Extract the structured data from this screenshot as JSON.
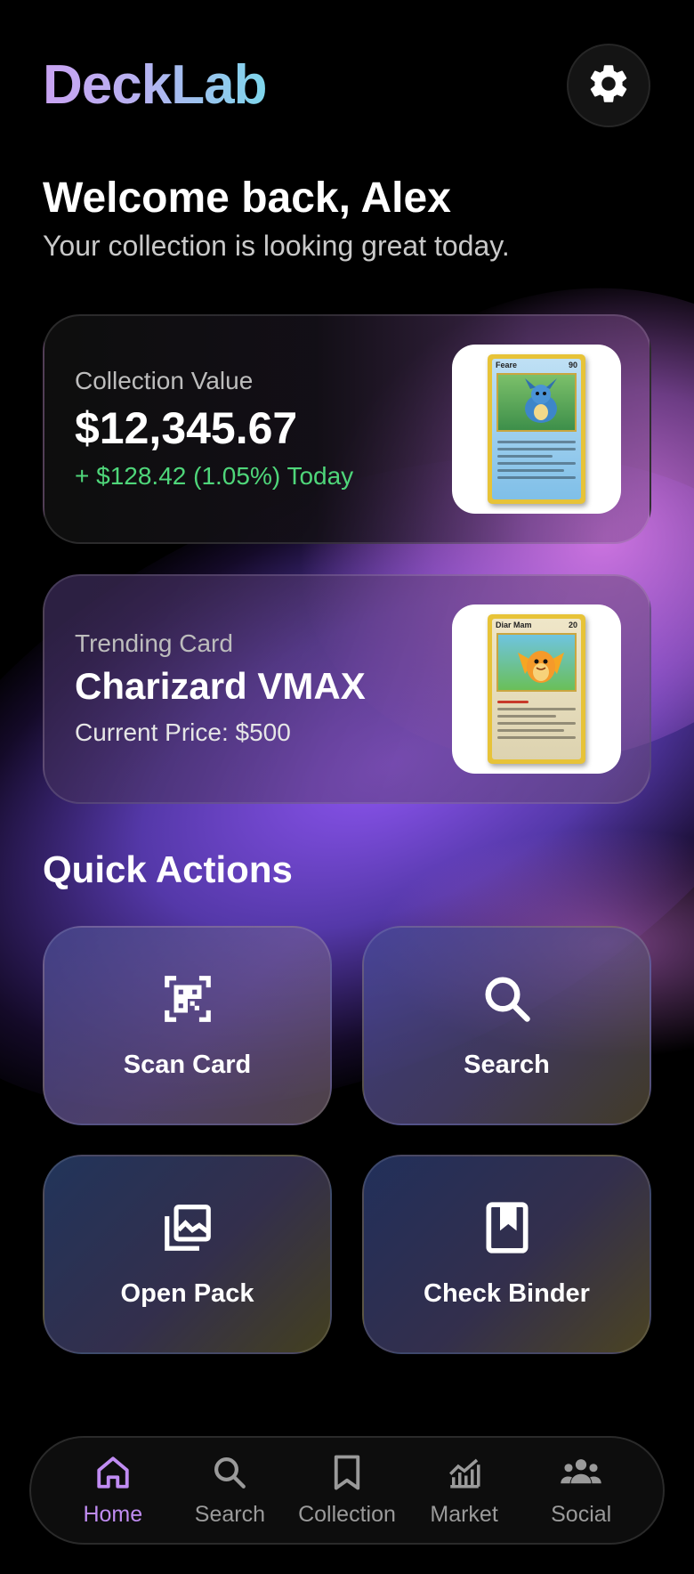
{
  "app": {
    "title": "DeckLab"
  },
  "header": {
    "settings_icon": "gear-icon"
  },
  "greeting": {
    "title": "Welcome back, Alex",
    "subtitle": "Your collection is looking great today."
  },
  "collection_card": {
    "label": "Collection Value",
    "value": "$12,345.67",
    "change": "+ $128.42 (1.05%) Today",
    "change_color": "#4fd67a",
    "card_name": "Feare",
    "card_hp": "90"
  },
  "trending_card": {
    "label": "Trending Card",
    "name": "Charizard VMAX",
    "price": "Current Price: $500",
    "card_name": "Diar Mam",
    "card_hp": "20"
  },
  "quick_actions": {
    "title": "Quick Actions",
    "items": [
      {
        "label": "Scan Card",
        "icon": "qr-scan-icon"
      },
      {
        "label": "Search",
        "icon": "search-icon"
      },
      {
        "label": "Open Pack",
        "icon": "photo-stack-icon"
      },
      {
        "label": "Check Binder",
        "icon": "bookmark-book-icon"
      }
    ]
  },
  "nav": {
    "active_color": "#c08cf2",
    "items": [
      {
        "label": "Home",
        "icon": "home-icon",
        "active": true
      },
      {
        "label": "Search",
        "icon": "search-icon",
        "active": false
      },
      {
        "label": "Collection",
        "icon": "bookmark-icon",
        "active": false
      },
      {
        "label": "Market",
        "icon": "chart-icon",
        "active": false
      },
      {
        "label": "Social",
        "icon": "people-icon",
        "active": false
      }
    ]
  }
}
